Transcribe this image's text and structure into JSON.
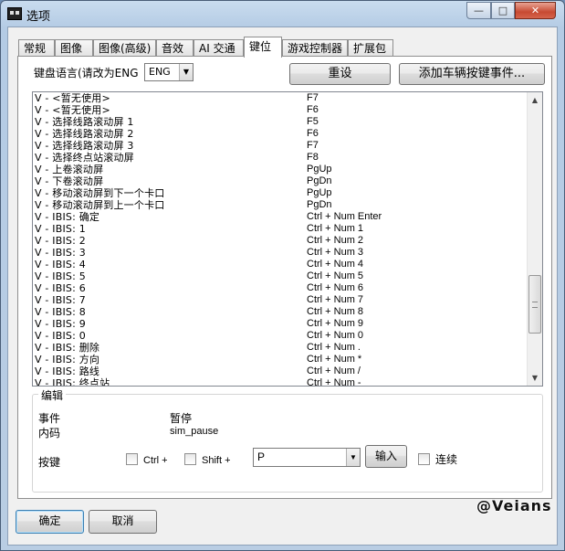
{
  "window": {
    "title": "选项",
    "minimize": "—",
    "maximize": "□",
    "close": "✕"
  },
  "tabs": [
    {
      "label": "常规"
    },
    {
      "label": "图像"
    },
    {
      "label": "图像(高级)"
    },
    {
      "label": "音效"
    },
    {
      "label": "AI 交通"
    },
    {
      "label": "键位"
    },
    {
      "label": "游戏控制器"
    },
    {
      "label": "扩展包"
    }
  ],
  "active_tab": "键位",
  "keyboard": {
    "lang_label": "键盘语言(请改为ENG",
    "lang_value": "ENG",
    "reset_label": "重设",
    "add_event_label": "添加车辆按键事件..."
  },
  "bindings": [
    {
      "event": "V - <暂无使用>",
      "key": "F7"
    },
    {
      "event": "V - <暂无使用>",
      "key": "F6"
    },
    {
      "event": "V - 选择线路滚动屏 1",
      "key": "F5"
    },
    {
      "event": "V - 选择线路滚动屏 2",
      "key": "F6"
    },
    {
      "event": "V - 选择线路滚动屏 3",
      "key": "F7"
    },
    {
      "event": "V - 选择终点站滚动屏",
      "key": "F8"
    },
    {
      "event": "V - 上卷滚动屏",
      "key": "PgUp"
    },
    {
      "event": "V - 下卷滚动屏",
      "key": "PgDn"
    },
    {
      "event": "V - 移动滚动屏到下一个卡口",
      "key": "PgUp"
    },
    {
      "event": "V - 移动滚动屏到上一个卡口",
      "key": "PgDn"
    },
    {
      "event": "V - IBIS: 确定",
      "key": "Ctrl + Num Enter"
    },
    {
      "event": "V - IBIS: 1",
      "key": "Ctrl + Num 1"
    },
    {
      "event": "V - IBIS: 2",
      "key": "Ctrl + Num 2"
    },
    {
      "event": "V - IBIS: 3",
      "key": "Ctrl + Num 3"
    },
    {
      "event": "V - IBIS: 4",
      "key": "Ctrl + Num 4"
    },
    {
      "event": "V - IBIS: 5",
      "key": "Ctrl + Num 5"
    },
    {
      "event": "V - IBIS: 6",
      "key": "Ctrl + Num 6"
    },
    {
      "event": "V - IBIS: 7",
      "key": "Ctrl + Num 7"
    },
    {
      "event": "V - IBIS: 8",
      "key": "Ctrl + Num 8"
    },
    {
      "event": "V - IBIS: 9",
      "key": "Ctrl + Num 9"
    },
    {
      "event": "V - IBIS: 0",
      "key": "Ctrl + Num 0"
    },
    {
      "event": "V - IBIS: 删除",
      "key": "Ctrl + Num ."
    },
    {
      "event": "V - IBIS: 方向",
      "key": "Ctrl + Num *"
    },
    {
      "event": "V - IBIS: 路线",
      "key": "Ctrl + Num /"
    },
    {
      "event": "V - IBIS: 终点站",
      "key": "Ctrl + Num -"
    }
  ],
  "scroll": {
    "up": "▲",
    "down": "▼"
  },
  "edit": {
    "group_title": "编辑",
    "event_label": "事件",
    "event_value": "暂停",
    "code_label": "内码",
    "code_value": "sim_pause",
    "key_label": "按键",
    "ctrl_label": "Ctrl +",
    "shift_label": "Shift +",
    "key_value": "P",
    "input_label": "输入",
    "repeat_label": "连续"
  },
  "footer": {
    "ok_label": "确定",
    "cancel_label": "取消"
  },
  "watermark": "@Veians",
  "icons": {
    "dropdown": "▼"
  }
}
